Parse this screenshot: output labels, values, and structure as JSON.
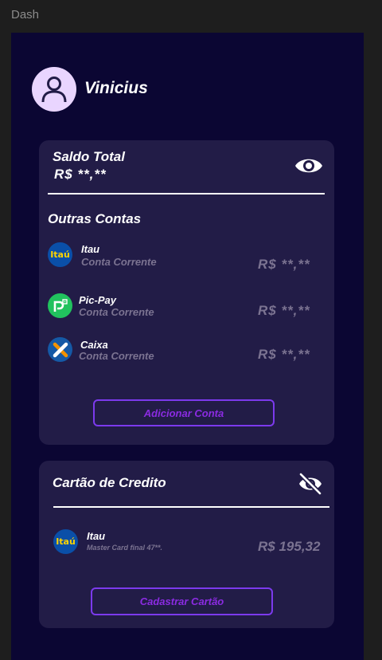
{
  "frame": {
    "label": "Dash"
  },
  "profile": {
    "name": "Vinicius",
    "avatar_icon": "user-icon"
  },
  "balance_card": {
    "title": "Saldo Total",
    "amount": "R$ **,**",
    "toggle_icon": "eye-icon",
    "other_accounts_title": "Outras Contas",
    "accounts": [
      {
        "bank": "Itau",
        "type": "Conta Corrente",
        "amount": "R$ **,**",
        "logo_text": "Itaú",
        "logo_icon": "itau-logo-icon"
      },
      {
        "bank": "Pic-Pay",
        "type": "Conta Corrente",
        "amount": "R$ **,**",
        "logo_icon": "picpay-logo-icon"
      },
      {
        "bank": "Caixa",
        "type": "Conta Corrente",
        "amount": "R$ **,**",
        "logo_icon": "caixa-logo-icon"
      }
    ],
    "add_button": "Adicionar Conta"
  },
  "credit_card": {
    "title": "Cartão de Credito",
    "toggle_icon": "eye-off-icon",
    "cards": [
      {
        "bank": "Itau",
        "description": "Master Card final 47**.",
        "amount": "R$ 195,32",
        "logo_text": "Itaú"
      }
    ],
    "register_button": "Cadastrar Cartão"
  },
  "colors": {
    "background": "#0b0633",
    "card": "#221c47",
    "accent": "#7c3aed",
    "muted_text": "#7b7391",
    "avatar_bg": "#e9d5ff"
  }
}
